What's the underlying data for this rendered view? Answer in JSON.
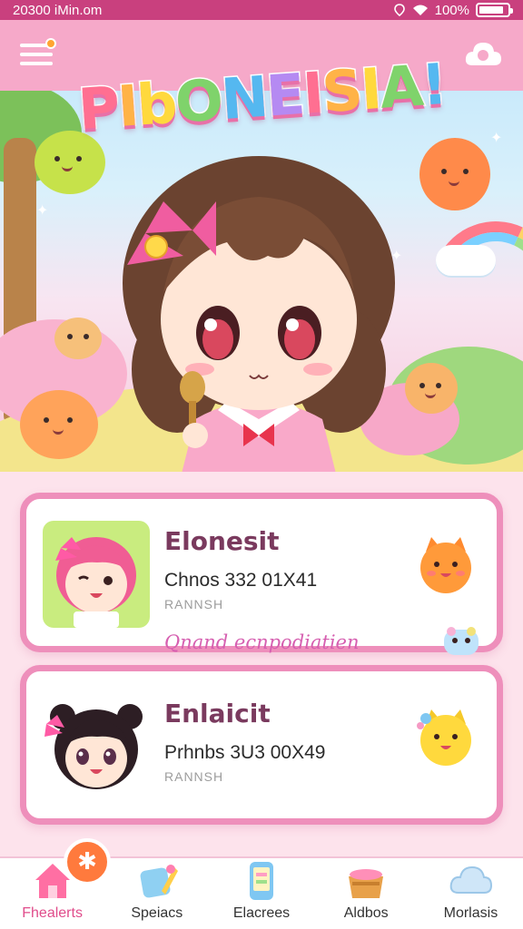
{
  "status_bar": {
    "time": "20300 iMin.om",
    "battery": "100%",
    "battery_level": 0.85
  },
  "app_bar": {
    "logo_text": "PIbONEISIA!",
    "menu_icon": "hamburger-menu-icon",
    "profile_icon": "profile-cloud-icon",
    "menu_badge_color": "#ffa531"
  },
  "cards": [
    {
      "title": "Elonesit",
      "line": "Chnos 332 01X41",
      "sub": "RANNSH",
      "link": "Qnand ecnpodiatien",
      "thumb_icon": "pink-haired-girl-avatar",
      "mascot_icon": "orange-cat-mascot-icon",
      "mini_icon": "blue-critter-icon"
    },
    {
      "title": "Enlaicit",
      "line": "Prhnbs 3U3 00X49",
      "sub": "RANNSH",
      "thumb_icon": "dark-haired-girl-avatar",
      "mascot_icon": "yellow-cat-mascot-icon"
    }
  ],
  "bottom_nav": [
    {
      "label": "Fhealerts",
      "icon": "home-icon",
      "active": true,
      "badge_icon": "star-badge-icon"
    },
    {
      "label": "Speiacs",
      "icon": "pencil-paper-icon",
      "active": false
    },
    {
      "label": "Elacrees",
      "icon": "phone-icon",
      "active": false
    },
    {
      "label": "Aldbos",
      "icon": "basket-icon",
      "active": false
    },
    {
      "label": "Morlasis",
      "icon": "cloud-icon",
      "active": false
    }
  ],
  "colors": {
    "status_bar": "#c9407e",
    "app_bar": "#f6a9c9",
    "card_border": "#ee8fbb",
    "card_title": "#7a3a5e",
    "accent": "#e04c8b"
  }
}
